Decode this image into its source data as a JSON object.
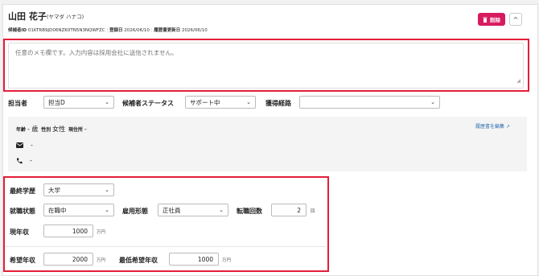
{
  "header": {
    "name": "山田 花子",
    "kana": "(ヤマダ ハナコ)",
    "candidate_id_label": "候補者ID",
    "candidate_id": "01KTRB9JD06NZK0TN5N3NQWFZC",
    "registered_label": "登録日",
    "registered_date": "2026/06/10",
    "updated_label": "履歴書更新日",
    "updated_date": "2026/06/10",
    "delete_label": "削除",
    "collapse_icon": "^"
  },
  "memo": {
    "placeholder": "任意のメモ欄です。入力内容は採用会社に送信されません。"
  },
  "assign": {
    "assignee_label": "担当者",
    "assignee_value": "担当D",
    "status_label": "候補者ステータス",
    "status_value": "サポート中",
    "source_label": "獲得経路",
    "source_value": ""
  },
  "profile": {
    "age_label": "年齢",
    "age_value": "- 歳",
    "gender_label": "性別",
    "gender_value": "女性",
    "address_label": "現住所",
    "address_value": "-",
    "email_value": "-",
    "phone_value": "-",
    "edit_link": "履歴書を編集"
  },
  "career": {
    "education_label": "最終学歴",
    "education_value": "大学",
    "employment_label": "就職状態",
    "employment_value": "在職中",
    "type_label": "雇用形態",
    "type_value": "正社員",
    "changes_label": "転職回数",
    "changes_value": "2",
    "changes_unit": "回",
    "income_label": "現年収",
    "income_value": "1000",
    "income_unit": "万円",
    "desired_label": "希望年収",
    "desired_value": "2000",
    "desired_unit": "万円",
    "min_desired_label": "最低希望年収",
    "min_desired_value": "1000",
    "min_desired_unit": "万円"
  }
}
